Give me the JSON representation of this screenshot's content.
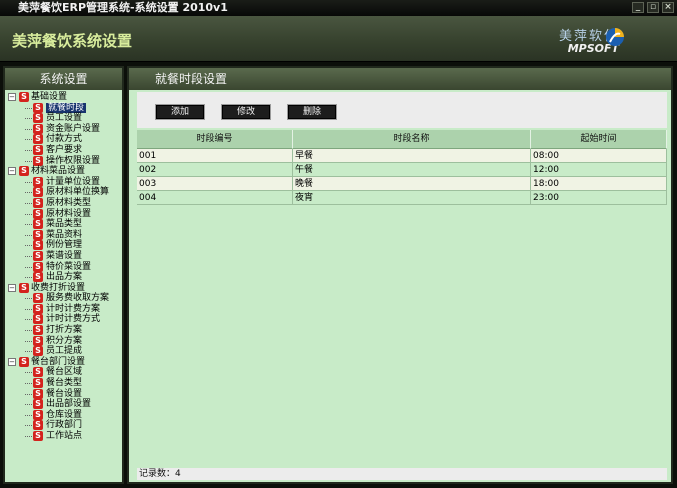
{
  "window": {
    "title": "美萍餐饮ERP管理系统-系统设置 2010v1",
    "controls": [
      "_",
      "▫",
      "×"
    ]
  },
  "banner": {
    "title": "美萍餐饮系统设置",
    "brand_cn": "美萍软件",
    "brand_en": "MPSOFT"
  },
  "sidebar": {
    "title": "系统设置",
    "groups": [
      {
        "label": "基础设置",
        "items": [
          "就餐时段",
          "员工设置",
          "资金账户设置",
          "付款方式",
          "客户要求",
          "操作权限设置"
        ]
      },
      {
        "label": "材料菜品设置",
        "items": [
          "计量单位设置",
          "原材料单位换算",
          "原材料类型",
          "原材料设置",
          "菜品类型",
          "菜品资料",
          "例份管理",
          "菜谱设置",
          "特价菜设置",
          "出品方案"
        ]
      },
      {
        "label": "收费打折设置",
        "items": [
          "服务费收取方案",
          "计时计费方案",
          "计时计费方式",
          "打折方案",
          "积分方案",
          "员工提成"
        ]
      },
      {
        "label": "餐台部门设置",
        "items": [
          "餐台区域",
          "餐台类型",
          "餐台设置",
          "出品部设置",
          "仓库设置",
          "行政部门",
          "工作站点"
        ]
      }
    ],
    "selected": "就餐时段"
  },
  "main": {
    "title": "就餐时段设置",
    "buttons": {
      "add": "添加",
      "edit": "修改",
      "delete": "删除"
    },
    "columns": [
      "时段编号",
      "时段名称",
      "起始时间"
    ],
    "rows": [
      [
        "001",
        "早餐",
        "08:00"
      ],
      [
        "002",
        "午餐",
        "12:00"
      ],
      [
        "003",
        "晚餐",
        "18:00"
      ],
      [
        "004",
        "夜宵",
        "23:00"
      ]
    ],
    "status": "记录数：4"
  }
}
